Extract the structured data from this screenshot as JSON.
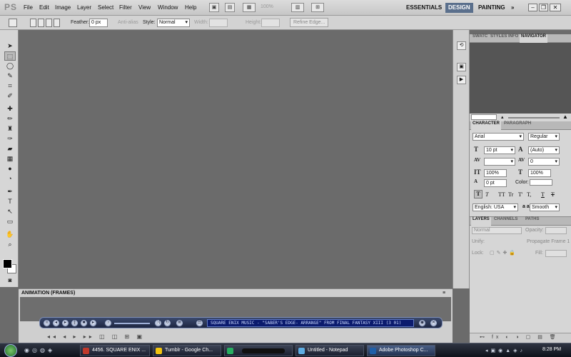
{
  "app": {
    "logo": "PS"
  },
  "menu": [
    "File",
    "Edit",
    "Image",
    "Layer",
    "Select",
    "Filter",
    "View",
    "Window",
    "Help"
  ],
  "menubar_tools": {
    "zoom": "100%"
  },
  "workspaces": {
    "essentials": "ESSENTIALS",
    "design": "DESIGN",
    "painting": "PAINTING",
    "more": "»"
  },
  "options": {
    "feather_label": "Feather:",
    "feather_value": "0 px",
    "antialias_label": "Anti-alias",
    "style_label": "Style:",
    "style_value": "Normal",
    "width_label": "Width:",
    "height_label": "Height:",
    "refine_edge": "Refine Edge..."
  },
  "panels": {
    "top_tabs": [
      "SWATC",
      "STYLES",
      "INFO",
      "NAVIGATOR"
    ],
    "char_tabs": [
      "CHARACTER",
      "PARAGRAPH"
    ],
    "layer_tabs": [
      "LAYERS",
      "CHANNELS",
      "PATHS"
    ]
  },
  "character": {
    "font_family": "Arial",
    "font_style": "Regular",
    "font_size": "10 pt",
    "leading": "(Auto)",
    "tracking": "0",
    "vscale": "100%",
    "hscale": "100%",
    "baseline": "0 pt",
    "color_label": "Color:",
    "language": "English: USA",
    "aa_label": "a a",
    "antialias": "Smooth",
    "style_buttons": [
      "T",
      "T",
      "TT",
      "Tr",
      "T'",
      "T,",
      "T",
      "T"
    ]
  },
  "layers": {
    "blend_mode": "Normal",
    "opacity_label": "Opacity:",
    "unify_label": "Unify:",
    "propagate_label": "Propagate Frame 1",
    "lock_label": "Lock:",
    "fill_label": "Fill:"
  },
  "animation": {
    "tab_label": "ANIMATION (FRAMES)"
  },
  "player": {
    "ticker": "SQUARE ENIX MUSIC - \"SABER'S EDGE- ARRANGE\" FROM FINAL FANTASY XIII (3 01)"
  },
  "taskbar": {
    "tasks": [
      {
        "label": "4456. SQUARE ENIX ...",
        "color": "#c0392b"
      },
      {
        "label": "Tumblr - Google Ch...",
        "color": "#f1c40f"
      },
      {
        "label": "",
        "color": "#27ae60"
      },
      {
        "label": "Untitled - Notepad",
        "color": "#5dade2"
      },
      {
        "label": "Adobe Photoshop C...",
        "color": "#1f5fa8"
      }
    ],
    "clock": "8:28 PM"
  },
  "colors": {
    "accent": "#5a6f8c",
    "canvas": "#6b6b6b"
  }
}
